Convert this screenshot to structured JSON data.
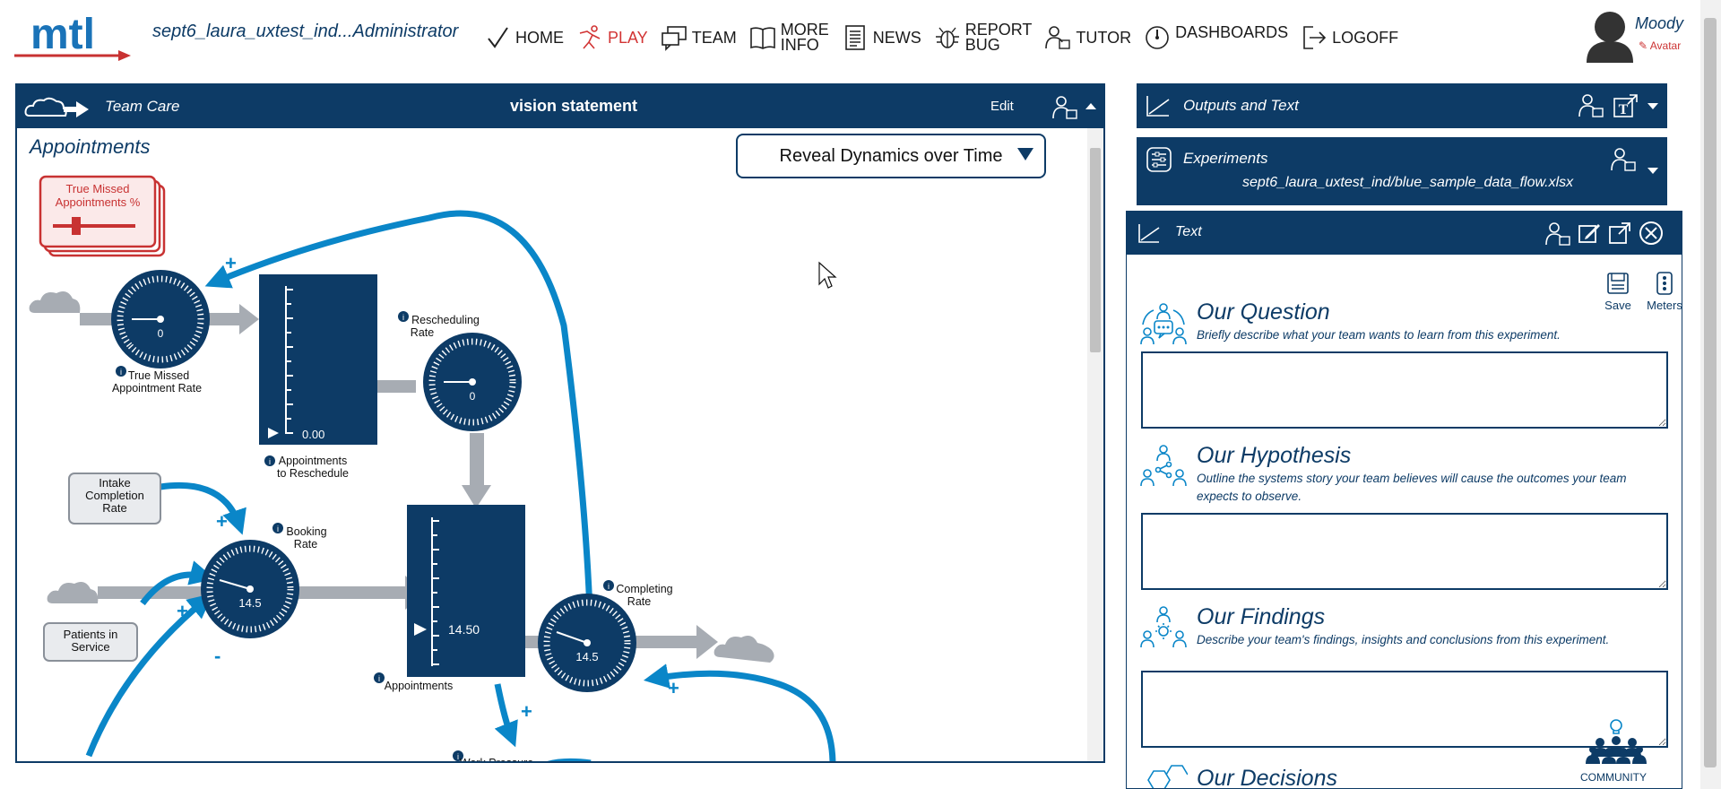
{
  "app": {
    "logo_text": "mtl",
    "session_title": "sept6_laura_uxtest_ind...Administrator",
    "nav": [
      {
        "label": "HOME",
        "icon": "check-icon"
      },
      {
        "label": "PLAY",
        "icon": "play-figure-icon"
      },
      {
        "label": "TEAM",
        "icon": "chat-bubbles-icon"
      },
      {
        "label": "MORE\nINFO",
        "icon": "book-icon"
      },
      {
        "label": "NEWS",
        "icon": "newspaper-icon"
      },
      {
        "label": "REPORT\nBUG",
        "icon": "bug-icon"
      },
      {
        "label": "TUTOR",
        "icon": "tutor-icon"
      },
      {
        "label": "DASHBOARDS",
        "icon": "gauge-icon"
      },
      {
        "label": "LOGOFF",
        "icon": "logoff-icon"
      }
    ],
    "user": {
      "name": "Moody",
      "sub": "✎ Avatar"
    }
  },
  "model_panel": {
    "title": "Team Care",
    "center_title": "vision statement",
    "edit_label": "Edit",
    "canvas_title": "Appointments",
    "reveal_label": "Reveal Dynamics over Time",
    "slider_label": "True Missed\nAppointments %",
    "gauges": {
      "true_missed": {
        "value": "0",
        "label": "True Missed\nAppointment Rate"
      },
      "rescheduling": {
        "value": "0",
        "label": "Rescheduling\nRate"
      },
      "booking": {
        "value": "14.5",
        "label": "Booking\nRate"
      },
      "completing": {
        "value": "14.5",
        "label": "Completing\nRate"
      }
    },
    "stocks": {
      "to_reschedule": {
        "value": "0.00",
        "label": "Appointments\nto Reschedule"
      },
      "appointments": {
        "value": "14.50",
        "label": "Appointments"
      }
    },
    "boxes": {
      "intake": "Intake\nCompletion\nRate",
      "patients": "Patients in\nService"
    },
    "polarity": {
      "plus": "+",
      "minus": "-"
    },
    "cut_label": "Work Pressure"
  },
  "outputs_panel": {
    "title": "Outputs and Text"
  },
  "experiments_panel": {
    "title": "Experiments",
    "file": "sept6_laura_uxtest_ind/blue_sample_data_flow.xlsx"
  },
  "text_panel": {
    "title": "Text",
    "save_label": "Save",
    "meters_label": "Meters",
    "sections": [
      {
        "title": "Our Question",
        "desc": "Briefly describe what your team wants to learn from this experiment."
      },
      {
        "title": "Our Hypothesis",
        "desc": "Outline the systems story your team believes will cause the outcomes your team expects to observe."
      },
      {
        "title": "Our Findings",
        "desc": "Describe your team's findings, insights and conclusions from this experiment."
      },
      {
        "title": "Our Decisions",
        "desc": ""
      }
    ],
    "community_label": "COMMUNITY"
  },
  "colors": {
    "navy": "#0d3b66",
    "flow_blue": "#0a86c8",
    "flow_gray": "#a7acb3",
    "red": "#d23434"
  }
}
